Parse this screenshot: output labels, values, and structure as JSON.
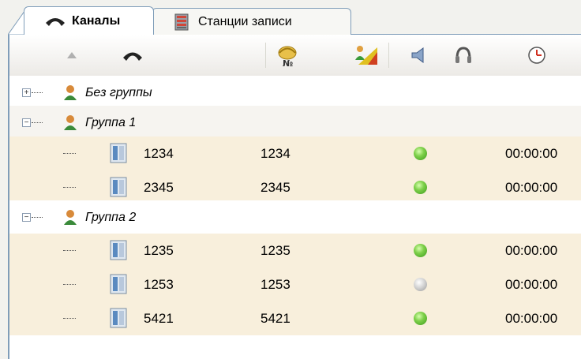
{
  "tabs": [
    {
      "label": "Каналы",
      "icon": "phone-handset-icon",
      "active": true
    },
    {
      "label": "Станции записи",
      "icon": "recording-station-icon",
      "active": false
    }
  ],
  "columns": [
    {
      "icon": "sort-ascending-icon"
    },
    {
      "icon": "phone-handset-icon"
    },
    {
      "icon": "number-phone-icon"
    },
    {
      "icon": "signal-level-icon"
    },
    {
      "icon": "speaker-icon"
    },
    {
      "icon": "headphones-icon"
    },
    {
      "icon": "clock-icon"
    }
  ],
  "groups": [
    {
      "label": "Без группы",
      "expanded": false,
      "channels": []
    },
    {
      "label": "Группа 1",
      "expanded": true,
      "channels": [
        {
          "number": "1234",
          "id": "1234",
          "active": true,
          "time": "00:00:00"
        },
        {
          "number": "2345",
          "id": "2345",
          "active": true,
          "time": "00:00:00"
        }
      ]
    },
    {
      "label": "Группа 2",
      "expanded": true,
      "channels": [
        {
          "number": "1235",
          "id": "1235",
          "active": true,
          "time": "00:00:00"
        },
        {
          "number": "1253",
          "id": "1253",
          "active": false,
          "time": "00:00:00"
        },
        {
          "number": "5421",
          "id": "5421",
          "active": true,
          "time": "00:00:00"
        }
      ]
    }
  ],
  "colors": {
    "status_on": "#5bbf2e",
    "status_off": "#c8c8c8",
    "row_highlight": "#f8efdc",
    "border": "#7f9db9"
  }
}
